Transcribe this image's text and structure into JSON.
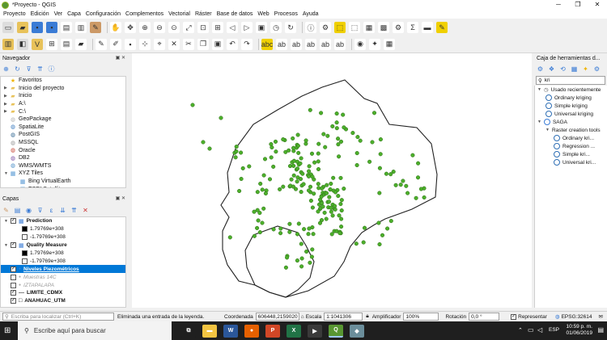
{
  "window": {
    "title": "*Proyecto - QGIS",
    "controls": [
      "─",
      "❐",
      "✕"
    ]
  },
  "menu": [
    "Proyecto",
    "Edición",
    "Ver",
    "Capa",
    "Configuración",
    "Complementos",
    "Vectorial",
    "Ráster",
    "Base de datos",
    "Web",
    "Procesos",
    "Ayuda"
  ],
  "browser": {
    "title": "Navegador",
    "items": [
      {
        "label": "Favoritos",
        "icon": "star-icon",
        "color": "#f0b400"
      },
      {
        "label": "Inicio del proyecto",
        "icon": "folder-icon",
        "color": "#e8c25a"
      },
      {
        "label": "Inicio",
        "icon": "folder-icon",
        "color": "#e8c25a"
      },
      {
        "label": "A:\\",
        "icon": "folder-icon",
        "color": "#e8c25a"
      },
      {
        "label": "C:\\",
        "icon": "folder-icon",
        "color": "#e8c25a"
      },
      {
        "label": "GeoPackage",
        "icon": "geopackage-icon",
        "color": "#b5b5b5"
      },
      {
        "label": "SpatiaLite",
        "icon": "spatialite-icon",
        "color": "#3b7bbf"
      },
      {
        "label": "PostGIS",
        "icon": "postgis-icon",
        "color": "#336791"
      },
      {
        "label": "MSSQL",
        "icon": "mssql-icon",
        "color": "#999"
      },
      {
        "label": "Oracle",
        "icon": "oracle-icon",
        "color": "#c74634"
      },
      {
        "label": "DB2",
        "icon": "db2-icon",
        "color": "#7a4ea3"
      },
      {
        "label": "WMS/WMTS",
        "icon": "wms-icon",
        "color": "#4b8ec6"
      },
      {
        "label": "XYZ Tiles",
        "icon": "xyz-tiles-icon",
        "color": "#5b9bd5"
      },
      {
        "label": "Bing VirtualEarth",
        "icon": "tiles-icon",
        "color": "#5b9bd5"
      },
      {
        "label": "ESRI Satellite",
        "icon": "tiles-icon",
        "color": "#5b9bd5"
      }
    ]
  },
  "layers": {
    "title": "Capas",
    "items": [
      {
        "label": "Prediction",
        "bold": true,
        "checked": true,
        "type": "group"
      },
      {
        "label": "1.79769e+308",
        "swatch": "#000000"
      },
      {
        "label": "-1.79769e+308",
        "swatch": "#ffffff"
      },
      {
        "label": "Quality Measure",
        "bold": true,
        "checked": true,
        "type": "group"
      },
      {
        "label": "1.79769e+308",
        "swatch": "#000000"
      },
      {
        "label": "-1.79769e+308",
        "swatch": "#ffffff"
      },
      {
        "label": "Niveles Piezométricos",
        "checked": true,
        "selected": true
      },
      {
        "label": "Muestras 14C",
        "checked": false,
        "grey": true
      },
      {
        "label": "IZTAPALAPA",
        "checked": false,
        "grey": true
      },
      {
        "label": "LIMITE_CDMX",
        "checked": true,
        "bold": true
      },
      {
        "label": "ANAHUAC_UTM",
        "checked": true,
        "bold": true
      }
    ]
  },
  "toolbox": {
    "title": "Caja de herramientas d...",
    "search": "kri",
    "items": [
      {
        "label": "Usado recientemente",
        "level": 0,
        "kind": "clock"
      },
      {
        "label": "Ordinary kriging",
        "level": 1,
        "kind": "gear"
      },
      {
        "label": "Simple kriging",
        "level": 1,
        "kind": "gear"
      },
      {
        "label": "Universal kriging",
        "level": 1,
        "kind": "gear"
      },
      {
        "label": "SAGA",
        "level": 0,
        "kind": "saga"
      },
      {
        "label": "Raster creation tools",
        "level": 1,
        "kind": "none"
      },
      {
        "label": "Ordinary kri...",
        "level": 2,
        "kind": "gear"
      },
      {
        "label": "Regression ...",
        "level": 2,
        "kind": "gear"
      },
      {
        "label": "Simple kri...",
        "level": 2,
        "kind": "gear"
      },
      {
        "label": "Universal kri...",
        "level": 2,
        "kind": "gear"
      }
    ]
  },
  "status": {
    "locate_placeholder": "Escriba para localizar (Ctrl+K)",
    "message": "Eliminada una entrada de la leyenda.",
    "coord_label": "Coordenada",
    "coord_value": "606448,2159020",
    "scale_label": "Escala",
    "scale_value": "1:1041306",
    "magnifier_label": "Amplificador",
    "magnifier_value": "100%",
    "rotation_label": "Rotación",
    "rotation_value": "0,0 °",
    "render_label": "Representar",
    "crs": "EPSG:32614"
  },
  "taskbar": {
    "search_placeholder": "Escribe aquí para buscar",
    "apps": [
      {
        "name": "task-view",
        "label": "⧉",
        "color": "#1f1f1f"
      },
      {
        "name": "file-explorer",
        "label": "▬",
        "color": "#f4c542"
      },
      {
        "name": "word",
        "label": "W",
        "color": "#2b579a"
      },
      {
        "name": "firefox",
        "label": "●",
        "color": "#e66000"
      },
      {
        "name": "powerpoint",
        "label": "P",
        "color": "#d24726"
      },
      {
        "name": "excel",
        "label": "X",
        "color": "#217346"
      },
      {
        "name": "media",
        "label": "▶",
        "color": "#3a3a3a"
      },
      {
        "name": "qgis",
        "label": "Q",
        "color": "#589632"
      },
      {
        "name": "app-bird",
        "label": "◆",
        "color": "#6b8e9b"
      }
    ],
    "lang": "ESP",
    "time": "10:59 p. m.",
    "date": "01/06/2019"
  },
  "map": {
    "point_color": "#4caf2b",
    "outline_color": "#222222"
  }
}
